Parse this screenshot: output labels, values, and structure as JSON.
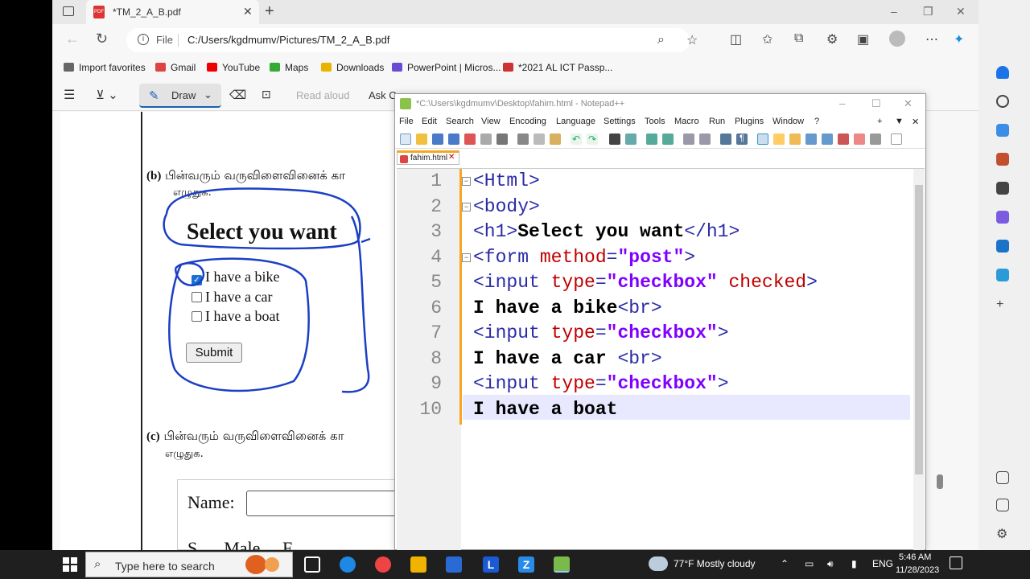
{
  "browser": {
    "tab_title": "*TM_2_A_B.pdf",
    "tab_close": "✕",
    "new_tab": "+",
    "window_min": "–",
    "window_restore": "❐",
    "window_close": "✕",
    "address_prefix": "File",
    "address_url": "C:/Users/kgdmumv/Pictures/TM_2_A_B.pdf",
    "favorites": [
      {
        "label": "Import favorites",
        "color": "#666"
      },
      {
        "label": "Gmail",
        "color": "#d44"
      },
      {
        "label": "YouTube",
        "color": "#e00"
      },
      {
        "label": "Maps",
        "color": "#3a3"
      },
      {
        "label": "Downloads",
        "color": "#e8b400"
      },
      {
        "label": "PowerPoint | Micros...",
        "color": "#6a4cd4"
      },
      {
        "label": "*2021 AL ICT Passp...",
        "color": "#c33"
      }
    ]
  },
  "pdf_toolbar": {
    "draw_label": "Draw",
    "read_aloud": "Read aloud",
    "ask": "Ask C"
  },
  "pdf": {
    "q_b_label": "(b)",
    "q_b_text": "பின்வரும் வருவிளைவினைக் கா",
    "q_b_text2": "எழுதுக.",
    "h1": "Select you want",
    "checkboxes": [
      {
        "label": "I have a bike",
        "checked": true
      },
      {
        "label": "I have a car",
        "checked": false
      },
      {
        "label": "I have a boat",
        "checked": false
      }
    ],
    "submit": "Submit",
    "q_c_label": "(c)",
    "q_c_text": "பின்வரும் வருவிளைவினைக் கா",
    "q_c_text2": "எழுதுக.",
    "name_label": "Name:",
    "partial_text": "S      Male     F      "
  },
  "notepad": {
    "title": "*C:\\Users\\kgdmumv\\Desktop\\fahim.html - Notepad++",
    "menu": [
      "File",
      "Edit",
      "Search",
      "View",
      "Encoding",
      "Language",
      "Settings",
      "Tools",
      "Macro",
      "Run",
      "Plugins",
      "Window",
      "?"
    ],
    "menu_right": [
      "+",
      "▼",
      "✕"
    ],
    "tab": "fahim.html",
    "tab_close": "✕",
    "line_numbers": [
      "1",
      "2",
      "3",
      "4",
      "5",
      "6",
      "7",
      "8",
      "9",
      "10"
    ],
    "lines": {
      "l1": "<Html>",
      "l2": "<body>",
      "l3a": "<h1>",
      "l3b": "Select you want",
      "l3c": "</h1>",
      "l4a": "<form ",
      "l4b": "method",
      "l4c": "=",
      "l4d": "\"post\"",
      "l4e": ">",
      "l5a": "<input ",
      "l5b": "type",
      "l5c": "=",
      "l5d": "\"checkbox\"",
      "l5e": " checked",
      "l5f": ">",
      "l6a": "I have a bike",
      "l6b": "<br>",
      "l7a": "<input ",
      "l7b": "type",
      "l7c": "=",
      "l7d": "\"checkbox\"",
      "l7e": ">",
      "l8a": "I have a car ",
      "l8b": "<br>",
      "l9a": "<input ",
      "l9b": "type",
      "l9c": "=",
      "l9d": "\"checkbox\"",
      "l9e": ">",
      "l10": "I have a boat"
    }
  },
  "taskbar": {
    "search_placeholder": "Type here to search",
    "weather": "77°F  Mostly cloudy",
    "lang": "ENG",
    "time": "5:46 AM",
    "date": "11/28/2023"
  },
  "colors": {
    "accent": "#1a5fb4",
    "npp_tab": "#f5a623",
    "html_tag": "#2a2aa8",
    "html_attr": "#c00000",
    "html_string": "#8000ff",
    "ink": "#1a3fc4"
  }
}
